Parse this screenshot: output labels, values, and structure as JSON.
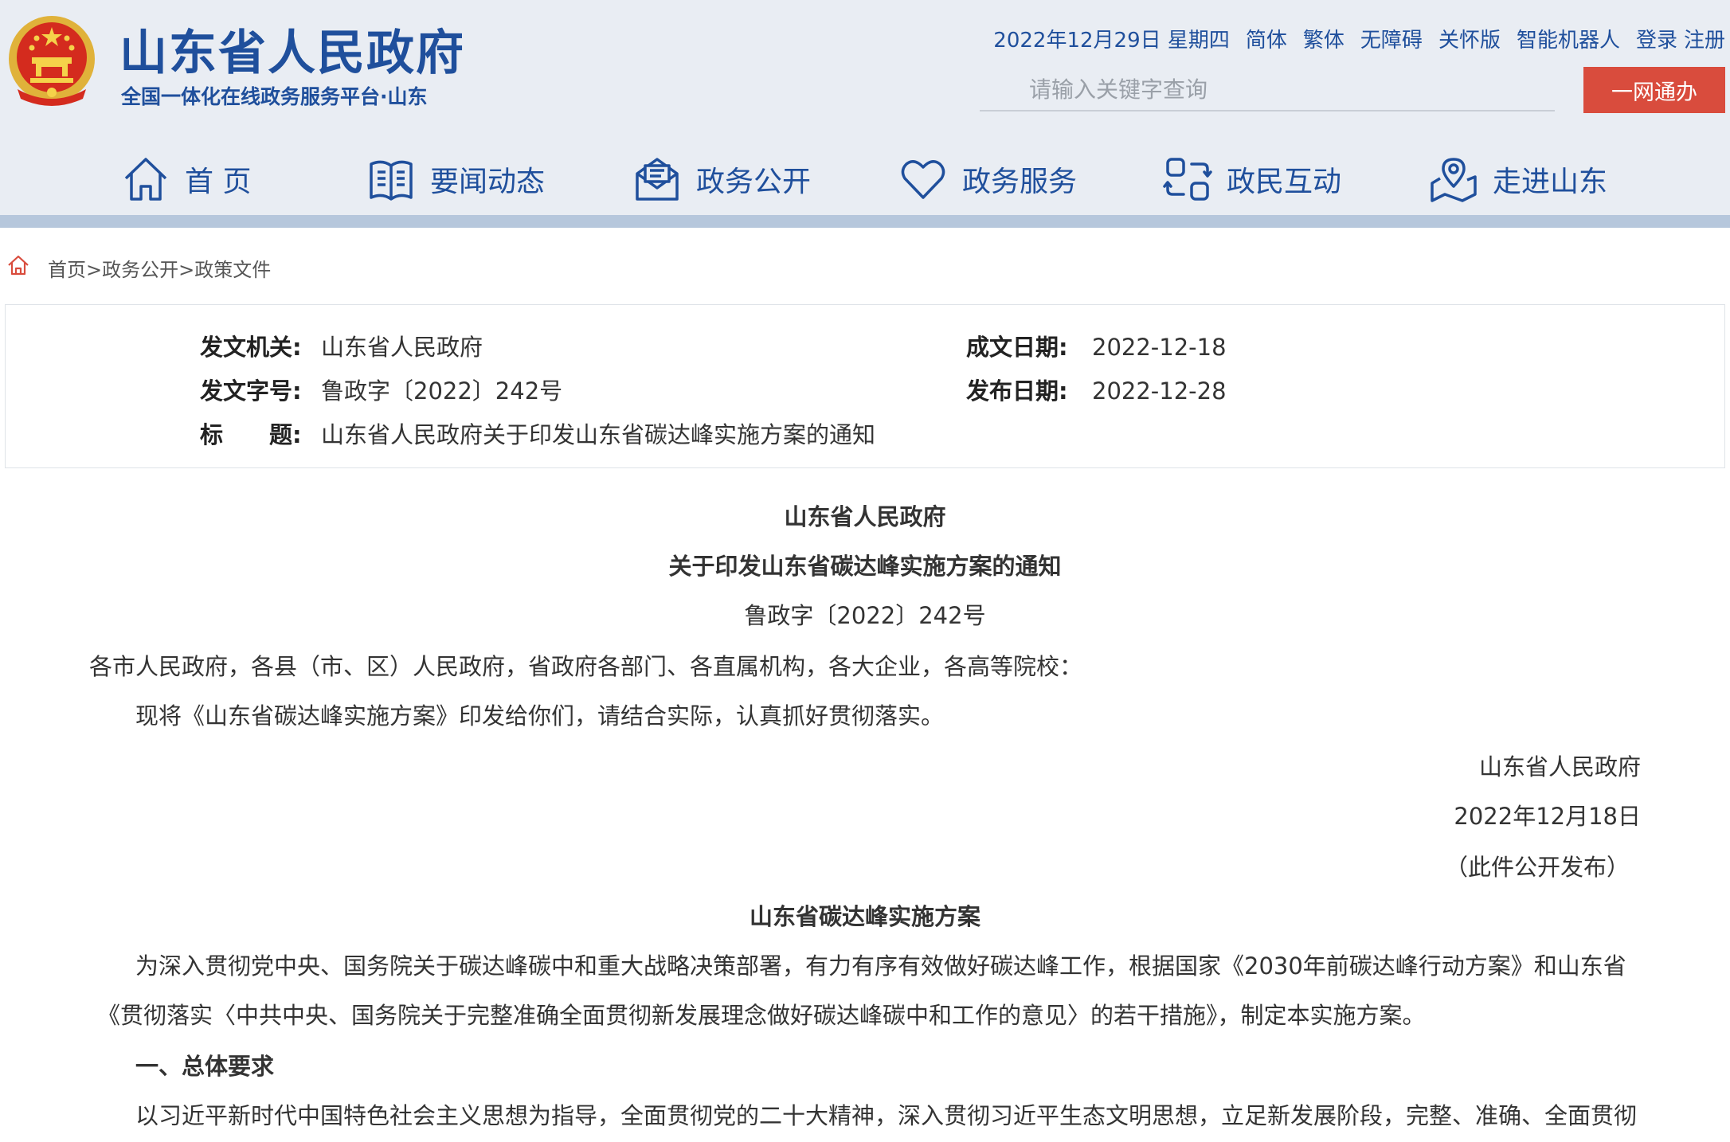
{
  "header": {
    "title": "山东省人民政府",
    "subtitle": "全国一体化在线政务服务平台·山东",
    "date": "2022年12月29日 星期四",
    "links": [
      "简体",
      "繁体",
      "无障碍",
      "关怀版",
      "智能机器人",
      "登录",
      "注册"
    ],
    "search_placeholder": "请输入关键字查询",
    "yiwang_button": "一网通办"
  },
  "nav": {
    "items": [
      {
        "label": "首 页",
        "icon": "home-icon"
      },
      {
        "label": "要闻动态",
        "icon": "book-icon"
      },
      {
        "label": "政务公开",
        "icon": "mail-open-icon"
      },
      {
        "label": "政务服务",
        "icon": "heart-icon"
      },
      {
        "label": "政民互动",
        "icon": "interaction-icon"
      },
      {
        "label": "走进山东",
        "icon": "map-pin-icon"
      }
    ]
  },
  "breadcrumb": {
    "items": [
      "首页",
      "政务公开",
      "政策文件"
    ],
    "separator": ">"
  },
  "info": {
    "issuer_label": "发文机关:",
    "issuer": "山东省人民政府",
    "doc_no_label": "发文字号:",
    "doc_no": "鲁政字〔2022〕242号",
    "title_label": "标　　题:",
    "title": "山东省人民政府关于印发山东省碳达峰实施方案的通知",
    "written_label": "成文日期:",
    "written_date": "2022-12-18",
    "publish_label": "发布日期:",
    "publish_date": "2022-12-28"
  },
  "document": {
    "heading1": "山东省人民政府",
    "heading2": "关于印发山东省碳达峰实施方案的通知",
    "doc_no": "鲁政字〔2022〕242号",
    "addressees": "各市人民政府，各县（市、区）人民政府，省政府各部门、各直属机构，各大企业，各高等院校：",
    "body1": "现将《山东省碳达峰实施方案》印发给你们，请结合实际，认真抓好贯彻落实。",
    "sign_org": "山东省人民政府",
    "sign_date": "2022年12月18日",
    "sign_note": "（此件公开发布）",
    "plan_title": "山东省碳达峰实施方案",
    "para1_line1": "为深入贯彻党中央、国务院关于碳达峰碳中和重大战略决策部署，有力有序有效做好碳达峰工作，根据国家《2030年前碳达峰行动方案》和山东省",
    "para1_line2": "《贯彻落实〈中共中央、国务院关于完整准确全面贯彻新发展理念做好碳达峰碳中和工作的意见〉的若干措施》，制定本实施方案。",
    "section1": "一、总体要求",
    "para2_line1": "以习近平新时代中国特色社会主义思想为指导，全面贯彻党的二十大精神，深入贯彻习近平生态文明思想，立足新发展阶段，完整、准确、全面贯彻"
  },
  "colors": {
    "brand_blue": "#1f4f9c",
    "header_bg": "#e9edf3",
    "nav_stripe": "#b6c7dc",
    "action_red": "#d94c3d"
  }
}
